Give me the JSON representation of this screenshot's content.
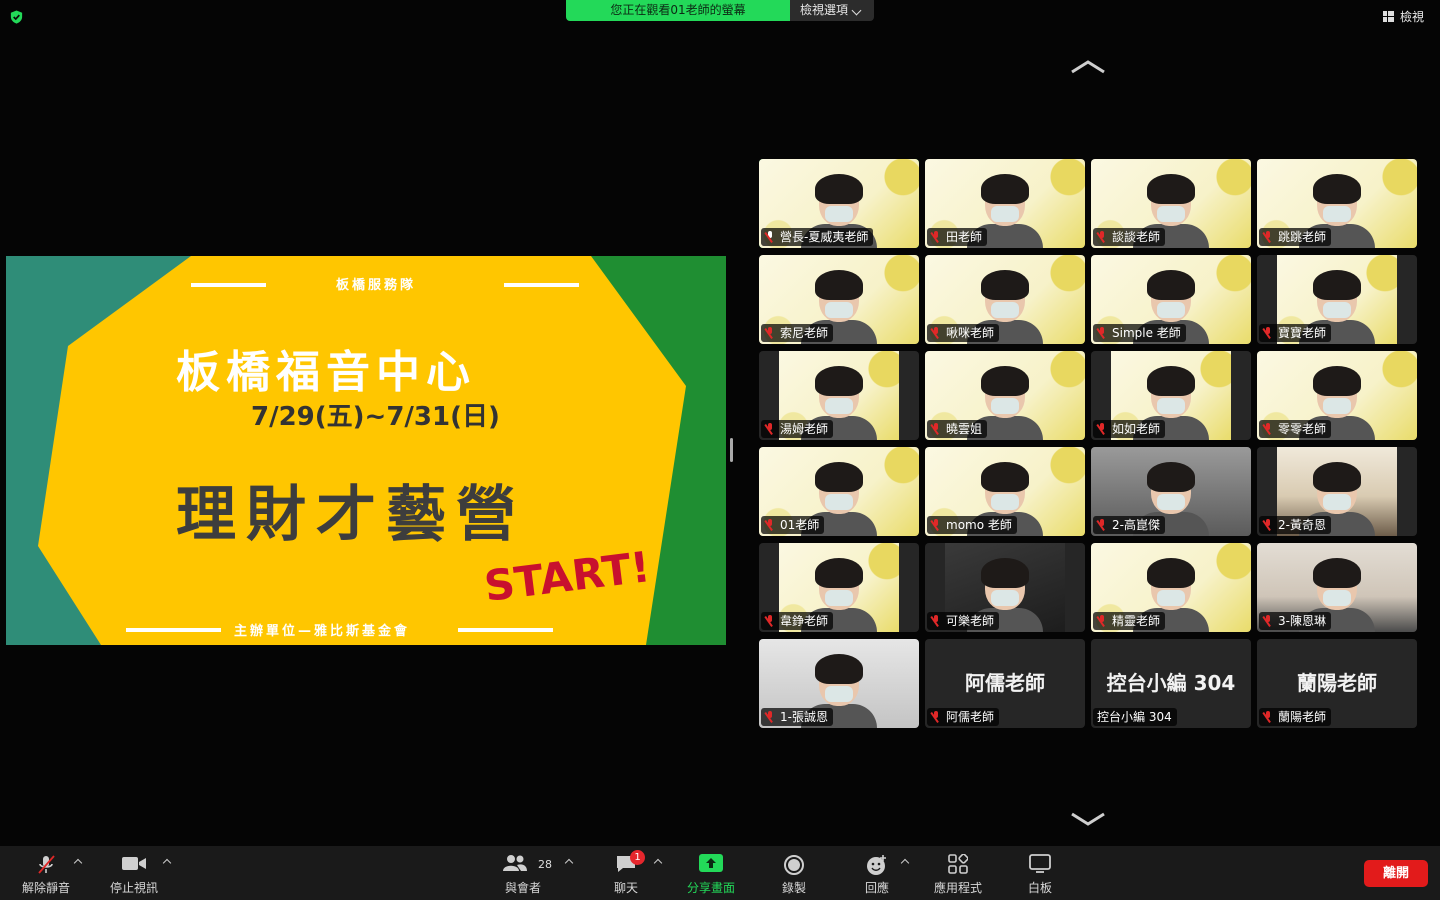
{
  "top": {
    "share_banner": "您正在觀看01老師的螢幕",
    "view_options": "檢視選項",
    "view": "檢視"
  },
  "slide": {
    "org": "板橋服務隊",
    "title": "板橋福音中心",
    "date": "7/29(五)~7/31(日)",
    "main": "理財才藝營",
    "start": "START!",
    "host": "主辦單位—雅比斯基金會"
  },
  "participants": [
    {
      "name": "營長-夏威夷老師",
      "video": "light",
      "active": true,
      "pin": true
    },
    {
      "name": "田老師",
      "video": "light"
    },
    {
      "name": "談談老師",
      "video": "light"
    },
    {
      "name": "跳跳老師",
      "video": "light"
    },
    {
      "name": "索尼老師",
      "video": "light"
    },
    {
      "name": "啾咪老師",
      "video": "light"
    },
    {
      "name": "Simple 老師",
      "video": "light"
    },
    {
      "name": "寶寶老師",
      "video": "light-narrow"
    },
    {
      "name": "湯姆老師",
      "video": "light-narrow"
    },
    {
      "name": "曉雲姐",
      "video": "light"
    },
    {
      "name": "如如老師",
      "video": "light-narrow"
    },
    {
      "name": "零零老師",
      "video": "light"
    },
    {
      "name": "01老師",
      "video": "light"
    },
    {
      "name": "momo 老師",
      "video": "light"
    },
    {
      "name": "2-高崑傑",
      "video": "kid"
    },
    {
      "name": "2-黃奇恩",
      "video": "room-narrow"
    },
    {
      "name": "韋錚老師",
      "video": "light-narrow"
    },
    {
      "name": "可樂老師",
      "video": "dark-narrow"
    },
    {
      "name": "精靈老師",
      "video": "light"
    },
    {
      "name": "3-陳恩琳",
      "video": "sofa"
    },
    {
      "name": "1-張誠恩",
      "video": "poster"
    },
    {
      "name": "阿儒老師",
      "video": "none",
      "big": "阿儒老師"
    },
    {
      "name": "控台小編 304",
      "video": "none",
      "big": "控台小編 304",
      "nomic": true
    },
    {
      "name": "蘭陽老師",
      "video": "none",
      "big": "蘭陽老師"
    }
  ],
  "toolbar": {
    "unmute": "解除靜音",
    "stop_video": "停止視訊",
    "participants": "與會者",
    "participants_count": "28",
    "chat": "聊天",
    "chat_badge": "1",
    "share": "分享畫面",
    "record": "錄製",
    "reactions": "回應",
    "apps": "應用程式",
    "whiteboard": "白板",
    "leave": "離開"
  },
  "colors": {
    "accent_green": "#23d959",
    "leave_red": "#e21b1b",
    "slide_yellow": "#ffc600",
    "slide_teal": "#2f8d78",
    "slide_green": "#1f8e32"
  }
}
